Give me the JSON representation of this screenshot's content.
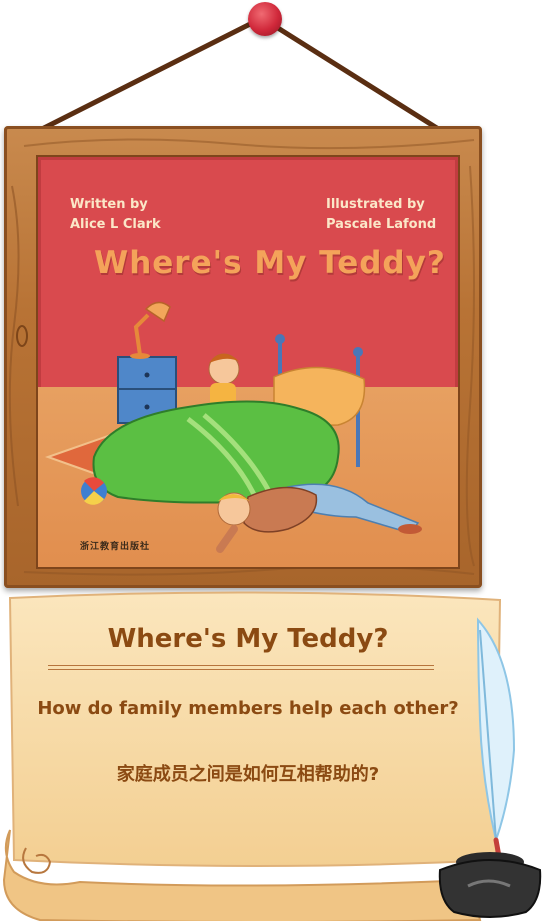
{
  "cover": {
    "written_by_label": "Written by",
    "author": "Alice L Clark",
    "illustrated_by_label": "Illustrated by",
    "illustrator": "Pascale Lafond",
    "title": "Where's My Teddy?",
    "publisher": "浙江教育出版社"
  },
  "scroll": {
    "title": "Where's My Teddy?",
    "question_en": "How do family members help each other?",
    "question_zh": "家庭成员之间是如何互相帮助的?"
  },
  "colors": {
    "cover_red": "#d94a4e",
    "title_orange": "#f4a35a",
    "scroll_text_brown": "#8b4a12",
    "frame_wood": "#b87335",
    "pin_red": "#d0283a"
  }
}
